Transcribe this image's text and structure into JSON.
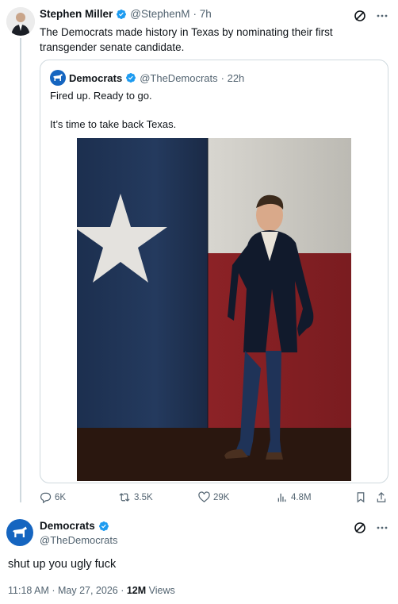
{
  "tweet": {
    "author_name": "Stephen Miller",
    "author_handle": "@StephenM",
    "time": "· 7h",
    "text": "The Democrats made history in Texas by nominating their first transgender senate candidate."
  },
  "quote": {
    "author_name": "Democrats",
    "author_handle": "@TheDemocrats",
    "time": "· 22h",
    "line1": "Fired up. Ready to go.",
    "line2": "It’s time to take back Texas."
  },
  "actions": {
    "replies": "6K",
    "reposts": "3.5K",
    "likes": "29K",
    "views": "4.8M"
  },
  "reply": {
    "author_name": "Democrats",
    "author_handle": "@TheDemocrats",
    "text": "shut up you ugly fuck",
    "timestamp": "11:18 AM · May 27, 2026 · ",
    "views_count": "12M",
    "views_label": " Views"
  },
  "colors": {
    "verified": "#1d9bf0",
    "democrat_blue": "#1565c0",
    "muted_text": "#536471"
  }
}
